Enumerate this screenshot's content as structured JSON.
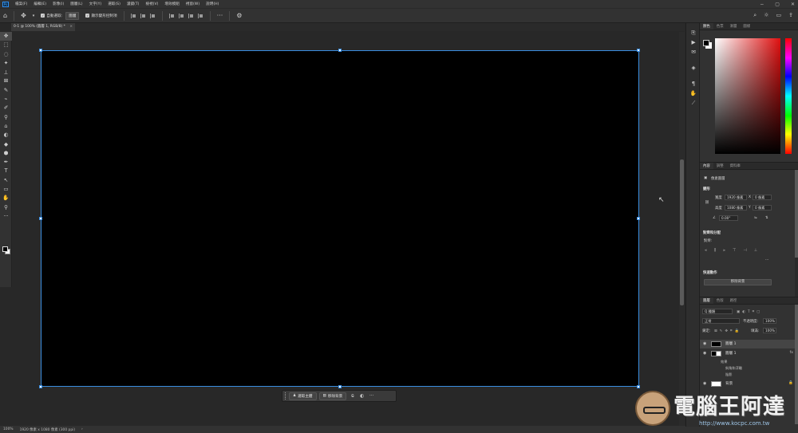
{
  "menubar": {
    "app_logo": "Ps",
    "items": [
      "檔案(F)",
      "編輯(E)",
      "影像(I)",
      "圖層(L)",
      "文字(Y)",
      "選取(S)",
      "濾鏡(T)",
      "檢視(V)",
      "增效模組",
      "視窗(W)",
      "說明(H)"
    ],
    "window_controls": [
      "−",
      "▢",
      "✕"
    ]
  },
  "options_bar": {
    "auto_select_label": "自動選取:",
    "auto_select_target": "圖層",
    "show_transform_label": "顯示變形控制項",
    "more": "···"
  },
  "document": {
    "tab_title": "0-1 @ 100% (圖層 1, RGB/8) *",
    "close": "×"
  },
  "toolbar": {
    "tools": [
      "✥",
      "⬚",
      "◌",
      "✦",
      "⟂",
      "⊠",
      "✎",
      "⌁",
      "✐",
      "⚲",
      "⌂",
      "◐",
      "◆",
      "⬢",
      "✒",
      "T",
      "↖",
      "▭",
      "✋",
      "⚲",
      "···"
    ]
  },
  "context_bar": {
    "select_subject": "選取主體",
    "remove_background": "移除背景",
    "more": "···"
  },
  "status": {
    "zoom": "100%",
    "doc_info": "1920 像素 x 1080 像素 (300 ppi)"
  },
  "color_panel": {
    "tabs": [
      "顏色",
      "色票",
      "漸層",
      "圖樣"
    ]
  },
  "properties_panel": {
    "tabs": [
      "內容",
      "調整",
      "資料庫"
    ],
    "layer_type": "像素圖層",
    "transform_title": "變形",
    "width_label": "寬度",
    "width_value": "1920 像素",
    "height_label": "高度",
    "height_value": "1080 像素",
    "x_label": "X",
    "x_value": "0 像素",
    "y_label": "Y",
    "y_value": "0 像素",
    "angle_value": "0.00°",
    "align_title": "對齊和分配",
    "align_label": "對齊:",
    "quick_actions_title": "快速動作",
    "remove_bg_button": "移除背景",
    "more": "···"
  },
  "layers_panel": {
    "tabs": [
      "圖層",
      "色版",
      "路徑"
    ],
    "kind_filter": "Q 種類",
    "blend_mode": "正常",
    "opacity_label": "不透明度:",
    "opacity_value": "100%",
    "lock_label": "鎖定:",
    "fill_label": "填滿:",
    "fill_value": "100%",
    "layers": [
      {
        "name": "圖層 1",
        "selected": true
      },
      {
        "name": "圖層 1",
        "fx": "fx"
      },
      {
        "name": "背景",
        "locked": true
      }
    ],
    "effects": [
      "效果",
      "斜角和浮雕",
      "陰影"
    ]
  },
  "watermark": {
    "title": "電腦王阿達",
    "url": "http://www.kocpc.com.tw"
  }
}
